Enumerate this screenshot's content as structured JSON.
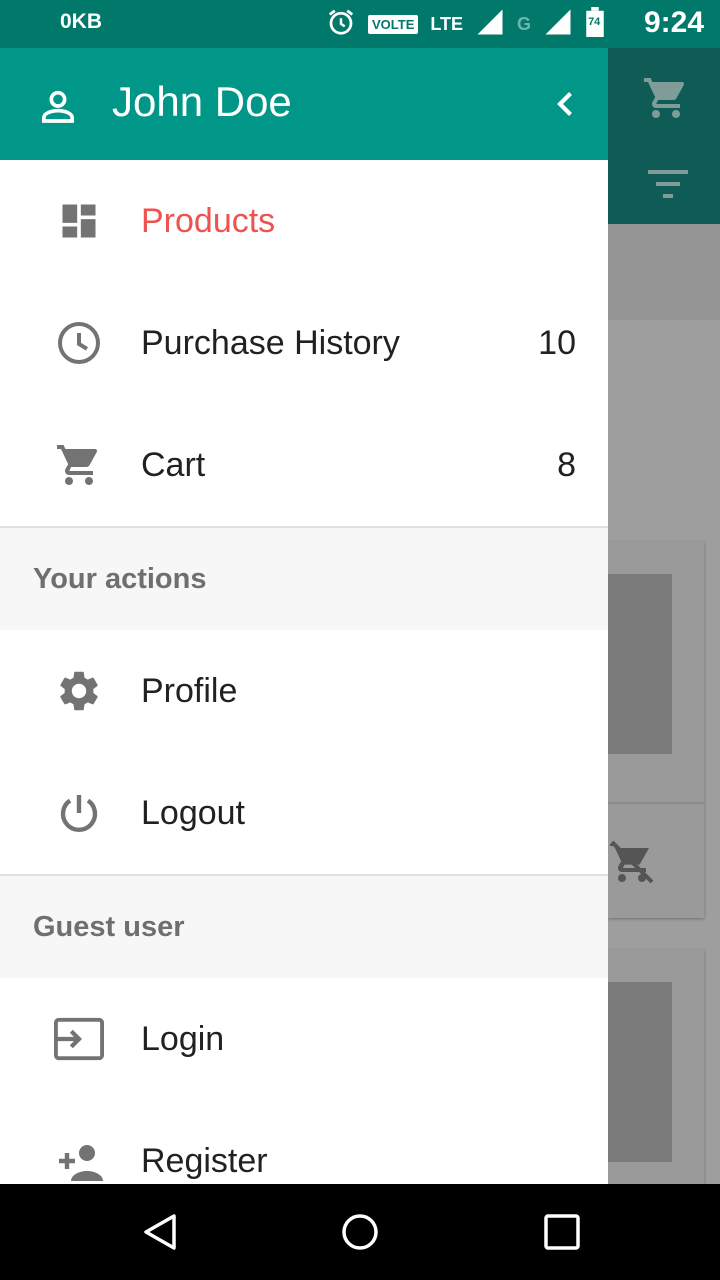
{
  "status_bar": {
    "data_counter": "0KB",
    "volte": "VOLTE",
    "lte": "LTE",
    "network_g": "G",
    "battery": "74",
    "time": "9:24"
  },
  "drawer": {
    "header": {
      "user_name": "John Doe"
    },
    "main_items": [
      {
        "label": "Products",
        "count": "",
        "icon": "dashboard-icon",
        "active": true
      },
      {
        "label": "Purchase History",
        "count": "10",
        "icon": "history-icon"
      },
      {
        "label": "Cart",
        "count": "8",
        "icon": "cart-icon"
      }
    ],
    "sections": [
      {
        "title": "Your actions",
        "items": [
          {
            "label": "Profile",
            "icon": "gear-icon"
          },
          {
            "label": "Logout",
            "icon": "power-icon"
          }
        ]
      },
      {
        "title": "Guest user",
        "items": [
          {
            "label": "Login",
            "icon": "login-icon"
          },
          {
            "label": "Register",
            "icon": "add-user-icon"
          }
        ]
      }
    ]
  },
  "colors": {
    "primary": "#009688",
    "primary_dark": "#00796b",
    "accent": "#ef5350"
  }
}
